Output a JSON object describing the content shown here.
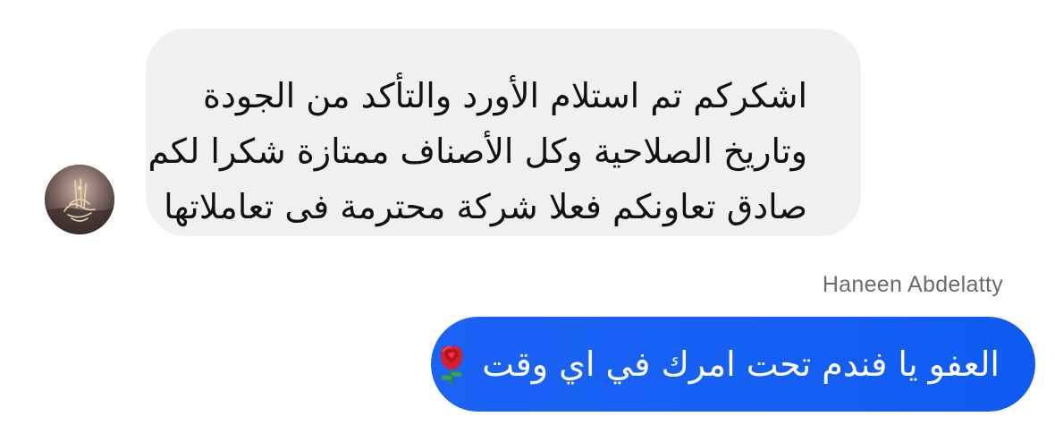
{
  "conversation": {
    "incoming": {
      "lines": [
        "اشكركم تم استلام الأورد والتأكد من الجودة",
        "وتاريخ الصلاحية وكل الأصناف ممتازة شكرا لكم",
        "صادق تعاونكم فعلا شركة محترمة فى تعاملاتها"
      ]
    },
    "outgoing": {
      "sender_name": "Haneen Abdelatty",
      "text": "العفو يا فندم تحت امرك في اي وقت",
      "emoji": "rose-icon"
    }
  },
  "colors": {
    "incoming_bubble": "#f0f0f2",
    "outgoing_bubble": "#1660f4",
    "incoming_text": "#111111",
    "outgoing_text": "#ffffff",
    "sender_name": "#6b6b6b"
  }
}
